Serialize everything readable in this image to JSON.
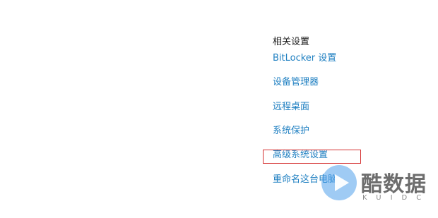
{
  "related_settings": {
    "title": "相关设置",
    "links": [
      {
        "label": "BitLocker 设置"
      },
      {
        "label": "设备管理器"
      },
      {
        "label": "远程桌面"
      },
      {
        "label": "系统保护"
      },
      {
        "label": "高级系统设置",
        "highlighted": true
      },
      {
        "label": "重命名这台电脑"
      }
    ]
  },
  "watermark": {
    "text": "酷数据",
    "subtext": "KUIDC",
    "icon": "play-logo-icon"
  },
  "colors": {
    "link": "#1e7fc1",
    "title": "#1a1a1a",
    "highlight": "#d43030",
    "background": "#ffffff"
  }
}
